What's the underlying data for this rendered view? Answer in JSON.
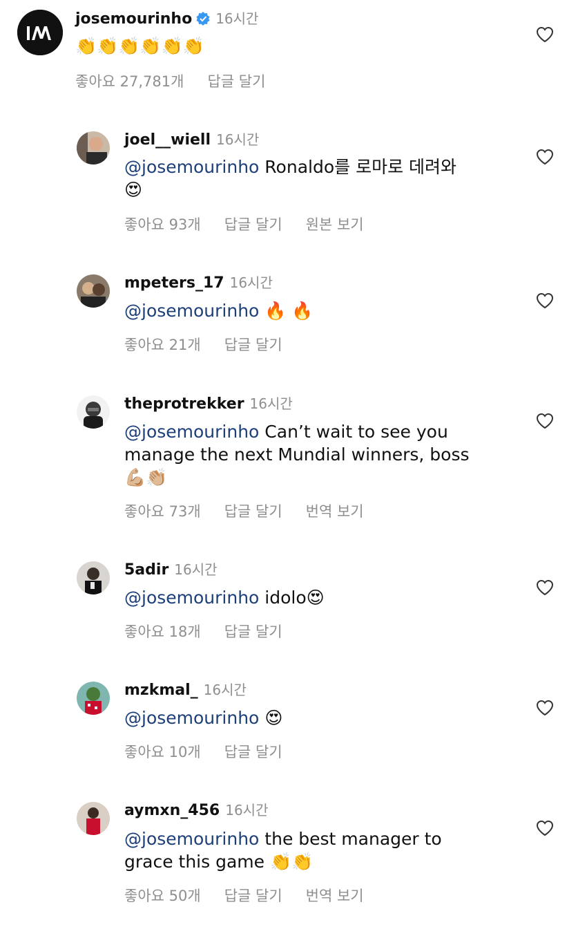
{
  "comments": [
    {
      "username": "josemourinho",
      "verified": true,
      "time": "16시간",
      "mention": "",
      "text": "",
      "emoji": "👏👏👏👏👏👏",
      "likes": "좋아요 27,781개",
      "reply": "답글 달기",
      "extra": ""
    },
    {
      "username": "joel__wiell",
      "time": "16시간",
      "mention": "@josemourinho",
      "text": " Ronaldo를 로마로 데려와",
      "emoji": "😍",
      "likes": "좋아요 93개",
      "reply": "답글 달기",
      "extra": "원본 보기"
    },
    {
      "username": "mpeters_17",
      "time": "16시간",
      "mention": "@josemourinho",
      "text": " ",
      "emoji": "🔥 🔥",
      "likes": "좋아요 21개",
      "reply": "답글 달기",
      "extra": ""
    },
    {
      "username": "theprotrekker",
      "time": "16시간",
      "mention": "@josemourinho",
      "text": " Can’t wait to see you manage the next Mundial winners, boss",
      "emoji": "💪🏼👏🏼",
      "likes": "좋아요 73개",
      "reply": "답글 달기",
      "extra": "번역 보기"
    },
    {
      "username": "5adir",
      "time": "16시간",
      "mention": "@josemourinho",
      "text": " idolo",
      "emoji": "😍",
      "likes": "좋아요 18개",
      "reply": "답글 달기",
      "extra": ""
    },
    {
      "username": "mzkmal_",
      "time": "16시간",
      "mention": "@josemourinho",
      "text": " ",
      "emoji": "😍",
      "likes": "좋아요 10개",
      "reply": "답글 달기",
      "extra": ""
    },
    {
      "username": "aymxn_456",
      "time": "16시간",
      "mention": "@josemourinho",
      "text": " the best manager to grace this game ",
      "emoji": "👏👏",
      "likes": "좋아요 50개",
      "reply": "답글 달기",
      "extra": "번역 보기"
    }
  ],
  "icons": {
    "heart": "heart-outline-icon",
    "verified": "verified-badge-icon"
  },
  "colors": {
    "mention": "#1d3f7a",
    "meta": "#8e8e8e",
    "verified": "#3897f0"
  }
}
